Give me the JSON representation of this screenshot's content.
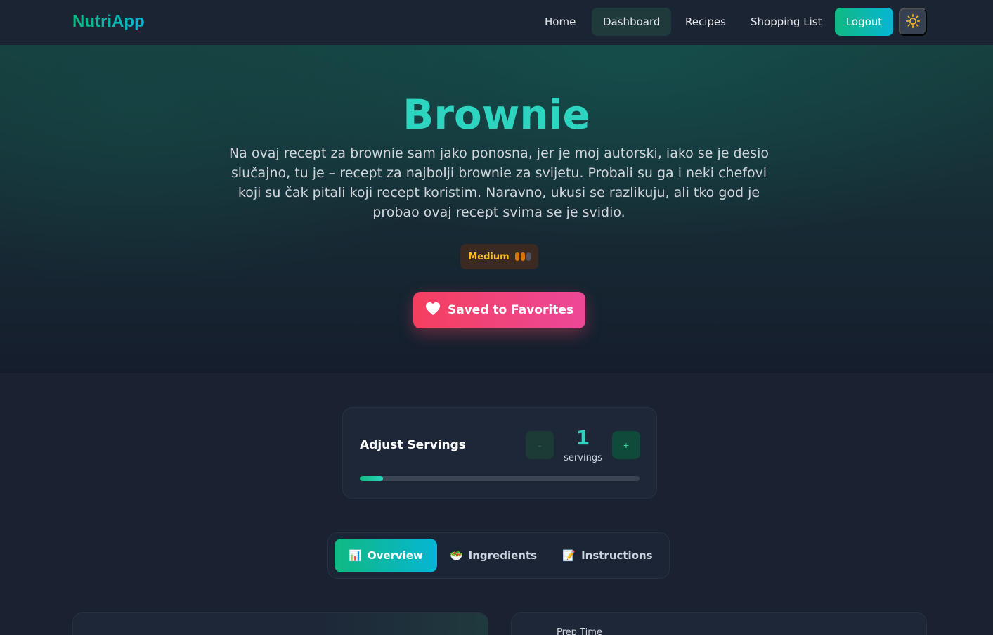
{
  "navbar": {
    "brand": "NutriApp",
    "links": [
      "Home",
      "Dashboard",
      "Recipes",
      "Shopping List"
    ],
    "active_link": "Dashboard",
    "logout_label": "Logout",
    "theme_icon": "sun-icon"
  },
  "hero": {
    "title": "Brownie",
    "description": "Na ovaj recept za brownie sam jako ponosna, jer je moj autorski, iako se je desio slučajno, tu je – recept za najbolji brownie za svijetu. Probali su ga i neki chefovi koji su čak pitali koji recept koristim. Naravno, ukusi se razlikuju, ali tko god je probao ovaj recept svima se je svidio.",
    "difficulty": {
      "label": "Medium",
      "level": 2,
      "max_level": 3,
      "active_color": "#d97706",
      "inactive_color": "#4b5563"
    },
    "favorite_label": "Saved to Favorites",
    "favorite_icon": "heart-icon"
  },
  "servings": {
    "title": "Adjust Servings",
    "minus_label": "-",
    "plus_label": "+",
    "value": "1",
    "unit": "servings",
    "progress_fraction": 0.083
  },
  "tabs": [
    {
      "label": "Overview",
      "icon": "📊",
      "active": true
    },
    {
      "label": "Ingredients",
      "icon": "🥗",
      "active": false
    },
    {
      "label": "Instructions",
      "icon": "📝",
      "active": false
    }
  ],
  "cards": {
    "prep_time_label": "Prep Time"
  },
  "colors": {
    "accent_teal": "#2dd4bf",
    "accent_green": "#10b981",
    "accent_cyan": "#06b6d4",
    "favorite_red": "#f43f5e",
    "favorite_pink": "#ec4899"
  }
}
